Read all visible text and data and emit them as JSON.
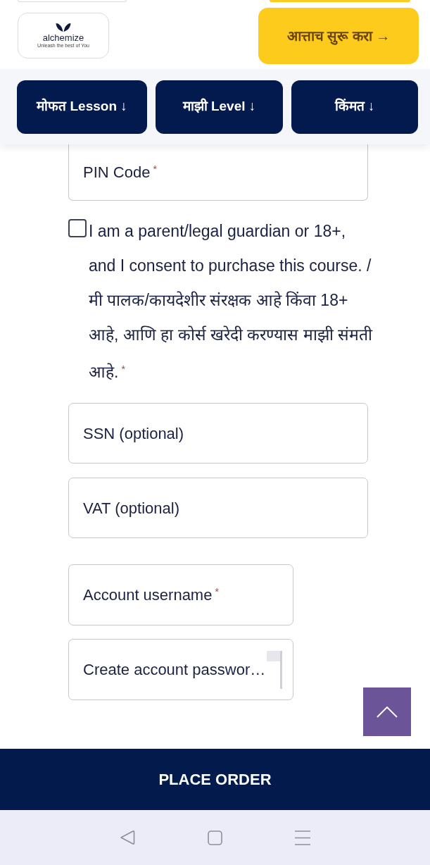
{
  "header": {
    "logo": {
      "name": "alchemize",
      "tagline": "Unleash the best of You"
    },
    "cta": "आत्ताच सुरू करा →"
  },
  "nav": [
    "मोफत Lesson ↓",
    "माझी Level ↓",
    "किंमत ↓"
  ],
  "pin_field": {
    "label": "PIN Code",
    "required_mark": "*"
  },
  "consent": {
    "checked": false,
    "text": "I am a parent/legal guardian or 18+, and I consent to purchase this course. / मी पालक/कायदेशीर संरक्षक आहे किंवा 18+ आहे, आणि हा कोर्स खरेदी करण्यास माझी संमती आहे.",
    "required_mark": "*"
  },
  "fields": [
    {
      "label": "SSN (optional)"
    },
    {
      "label": "VAT (optional)"
    }
  ],
  "account_fields": [
    {
      "kind": "text",
      "label": "Account username",
      "required_mark": "*"
    },
    {
      "kind": "password",
      "label": "Create account passwor…"
    }
  ],
  "place_order": "PLACE ORDER"
}
